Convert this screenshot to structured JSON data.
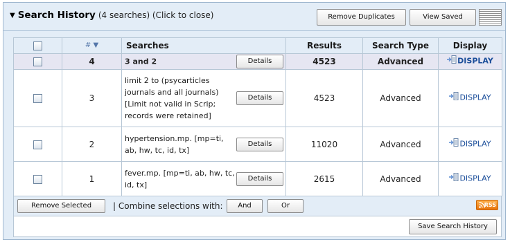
{
  "header": {
    "title": "Search History",
    "count_text": "(4 searches) (Click to close)",
    "remove_duplicates_label": "Remove Duplicates",
    "view_saved_label": "View Saved"
  },
  "table": {
    "columns": {
      "number": "#",
      "searches": "Searches",
      "results": "Results",
      "search_type": "Search Type",
      "display": "Display"
    },
    "sort_icon": "triangle-down-icon",
    "rows": [
      {
        "number": "4",
        "search": "3 and 2",
        "details_label": "Details",
        "results": "4523",
        "type": "Advanced",
        "display_label": "DISPLAY"
      },
      {
        "number": "3",
        "search": "limit 2 to (psycarticles journals and all journals) [Limit not valid in Scrip; records were retained]",
        "details_label": "Details",
        "results": "4523",
        "type": "Advanced",
        "display_label": "DISPLAY"
      },
      {
        "number": "2",
        "search": "hypertension.mp. [mp=ti, ab, hw, tc, id, tx]",
        "details_label": "Details",
        "results": "11020",
        "type": "Advanced",
        "display_label": "DISPLAY"
      },
      {
        "number": "1",
        "search": "fever.mp. [mp=ti, ab, hw, tc, id, tx]",
        "details_label": "Details",
        "results": "2615",
        "type": "Advanced",
        "display_label": "DISPLAY"
      }
    ]
  },
  "footer": {
    "remove_selected_label": "Remove Selected",
    "combine_label": "| Combine selections with:",
    "and_label": "And",
    "or_label": "Or",
    "rss_label": "RSS",
    "save_history_label": "Save Search History"
  },
  "colors": {
    "panel_bg": "#e3edf7",
    "border": "#b7c7d6",
    "link": "#1b4e9a",
    "rss": "#e8740d"
  }
}
